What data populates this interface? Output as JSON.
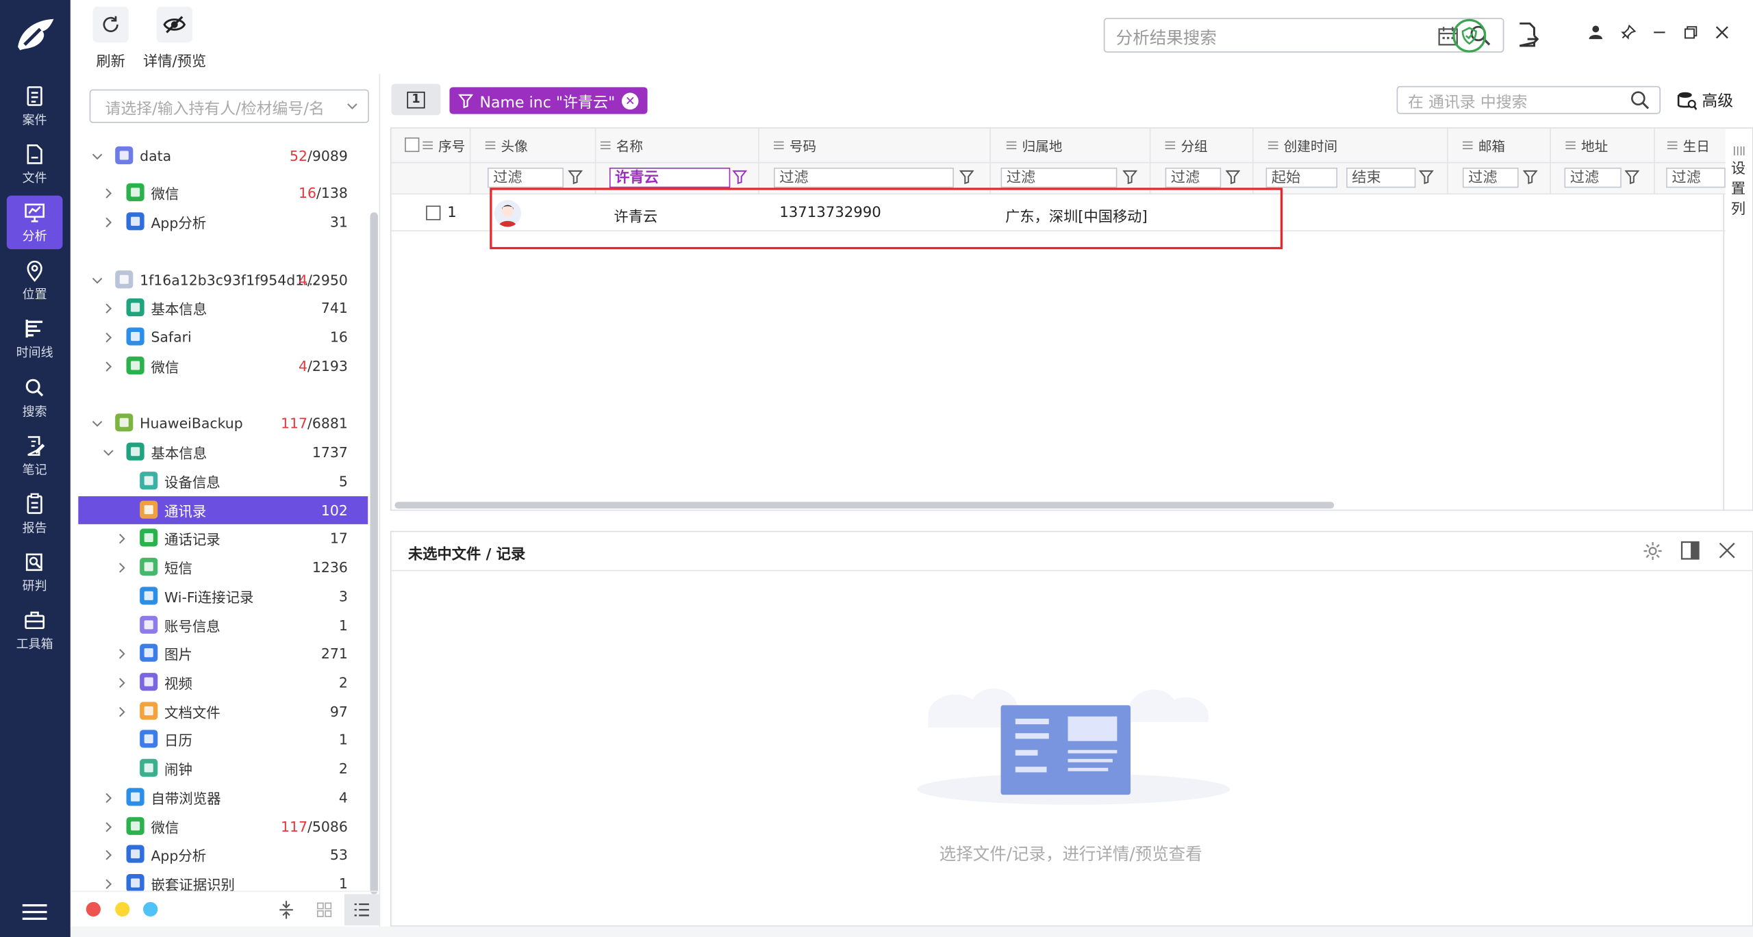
{
  "toolbar": {
    "refresh_label": "刷新",
    "details_label": "详情/预览",
    "search_placeholder": "分析结果搜索"
  },
  "nav": {
    "items": [
      {
        "label": "案件",
        "icon": "case-icon"
      },
      {
        "label": "文件",
        "icon": "file-icon"
      },
      {
        "label": "分析",
        "icon": "analysis-icon",
        "active": true
      },
      {
        "label": "位置",
        "icon": "location-icon"
      },
      {
        "label": "时间线",
        "icon": "timeline-icon"
      },
      {
        "label": "搜索",
        "icon": "search-icon"
      },
      {
        "label": "笔记",
        "icon": "note-icon"
      },
      {
        "label": "报告",
        "icon": "report-icon"
      },
      {
        "label": "研判",
        "icon": "judge-icon"
      },
      {
        "label": "工具箱",
        "icon": "toolbox-icon"
      }
    ]
  },
  "tree": {
    "search_placeholder": "请选择/输入持有人/检材编号/名",
    "rows": [
      {
        "label": "data",
        "red": "52",
        "count": "/9089",
        "icon": "device-icon",
        "indent": 0,
        "expanded": true
      },
      {
        "label": "微信",
        "red": "16",
        "count": "/138",
        "icon": "wechat-icon",
        "indent": 1
      },
      {
        "label": "App分析",
        "red": "",
        "count": "31",
        "icon": "apps-icon",
        "indent": 1
      },
      {
        "label": "1f16a12b3c93f1f954d1...",
        "red": "4",
        "count": "/2950",
        "icon": "apple-icon",
        "indent": 0,
        "expanded": true
      },
      {
        "label": "基本信息",
        "red": "",
        "count": "741",
        "icon": "info-icon",
        "indent": 1
      },
      {
        "label": "Safari",
        "red": "",
        "count": "16",
        "icon": "safari-icon",
        "indent": 1
      },
      {
        "label": "微信",
        "red": "4",
        "count": "/2193",
        "icon": "wechat-icon",
        "indent": 1
      },
      {
        "label": "HuaweiBackup",
        "red": "117",
        "count": "/6881",
        "icon": "android-icon",
        "indent": 0,
        "expanded": true
      },
      {
        "label": "基本信息",
        "red": "",
        "count": "1737",
        "icon": "info-icon",
        "indent": 1,
        "expanded": true
      },
      {
        "label": "设备信息",
        "red": "",
        "count": "5",
        "icon": "device-info-icon",
        "indent": 2
      },
      {
        "label": "通讯录",
        "red": "",
        "count": "102",
        "icon": "contacts-icon",
        "indent": 2,
        "selected": true
      },
      {
        "label": "通话记录",
        "red": "",
        "count": "17",
        "icon": "phone-icon",
        "indent": 2
      },
      {
        "label": "短信",
        "red": "",
        "count": "1236",
        "icon": "sms-icon",
        "indent": 2
      },
      {
        "label": "Wi-Fi连接记录",
        "red": "",
        "count": "3",
        "icon": "wifi-icon",
        "indent": 2
      },
      {
        "label": "账号信息",
        "red": "",
        "count": "1",
        "icon": "account-icon",
        "indent": 2
      },
      {
        "label": "图片",
        "red": "",
        "count": "271",
        "icon": "image-icon",
        "indent": 2
      },
      {
        "label": "视频",
        "red": "",
        "count": "2",
        "icon": "video-icon",
        "indent": 2
      },
      {
        "label": "文档文件",
        "red": "",
        "count": "97",
        "icon": "document-icon",
        "indent": 2
      },
      {
        "label": "日历",
        "red": "",
        "count": "1",
        "icon": "calendar-icon",
        "indent": 2
      },
      {
        "label": "闹钟",
        "red": "",
        "count": "2",
        "icon": "clock-icon",
        "indent": 2
      },
      {
        "label": "自带浏览器",
        "red": "",
        "count": "4",
        "icon": "browser-icon",
        "indent": 1
      },
      {
        "label": "微信",
        "red": "117",
        "count": "/5086",
        "icon": "wechat-icon",
        "indent": 1
      },
      {
        "label": "App分析",
        "red": "",
        "count": "53",
        "icon": "apps-icon",
        "indent": 1
      },
      {
        "label": "嵌套证据识别",
        "red": "",
        "count": "1",
        "icon": "monitor-icon",
        "indent": 1
      }
    ]
  },
  "grid": {
    "page_label": "1",
    "filter_chip": "Name inc \"许青云\"",
    "search_placeholder": "在 通讯录 中搜索",
    "advanced_label": "高级",
    "set_columns_label": "设置列",
    "columns": [
      "序号",
      "头像",
      "名称",
      "号码",
      "归属地",
      "分组",
      "创建时间",
      "邮箱",
      "地址",
      "生日"
    ],
    "filters": {
      "avatar": "过滤",
      "name": "许青云",
      "number": "过滤",
      "location": "过滤",
      "group": "过滤",
      "created_start": "起始",
      "created_end": "结束",
      "email": "过滤",
      "address": "过滤",
      "birthday": "过滤"
    },
    "rows": [
      {
        "index": "1",
        "name": "许青云",
        "number": "13713732990",
        "location": "广东，深圳[中国移动]"
      }
    ]
  },
  "detail": {
    "title": "未选中文件 / 记录",
    "empty_text": "选择文件/记录，进行详情/预览查看"
  },
  "colors": {
    "nav_bg": "#1c2a52",
    "accent": "#6b4fe0",
    "chip": "#9b30c0",
    "highlight_box": "#e8262b",
    "count_red": "#e0383c"
  }
}
